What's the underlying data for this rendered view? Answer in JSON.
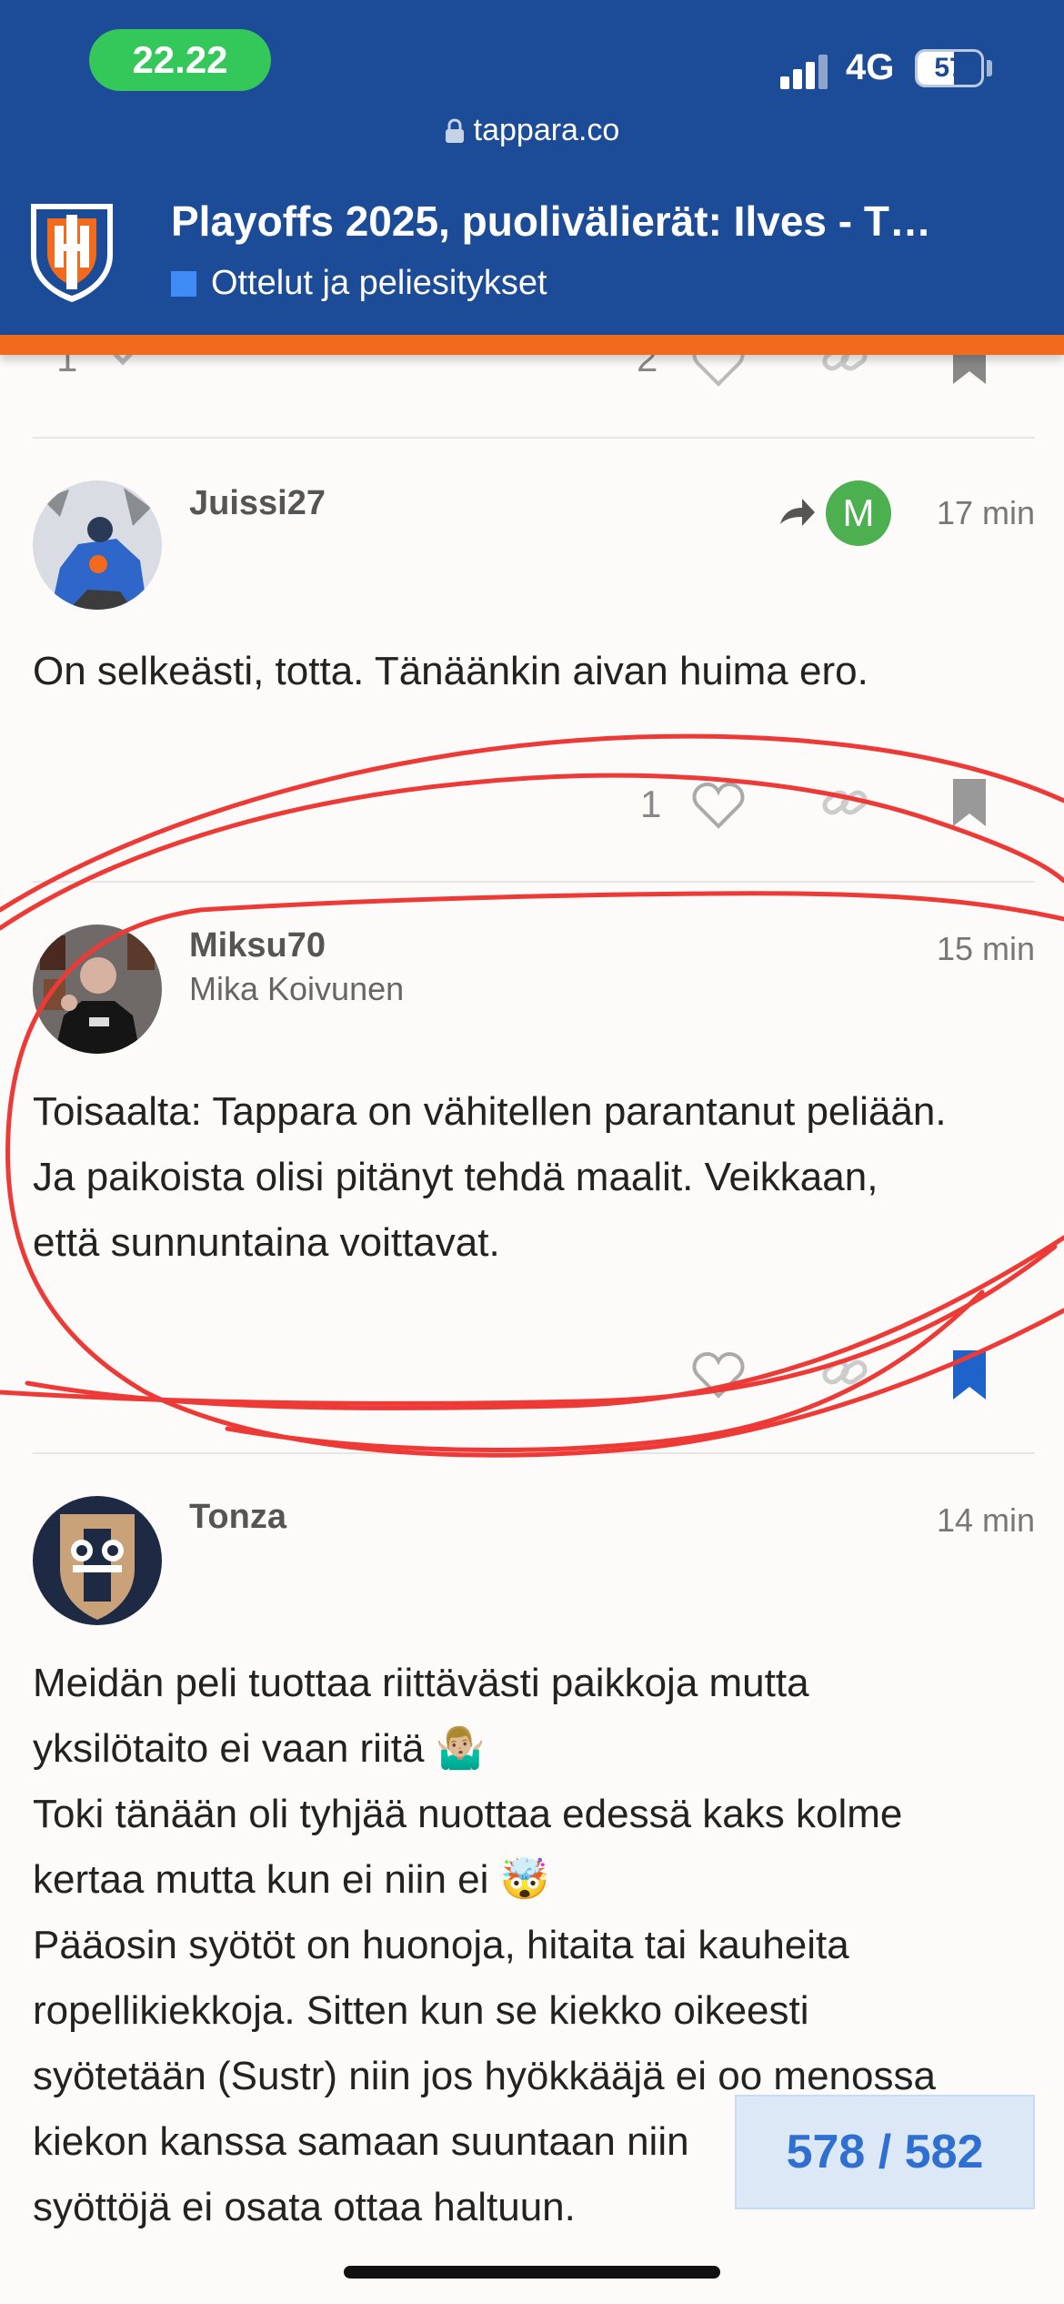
{
  "status_bar": {
    "time": "22.22",
    "network": "4G",
    "battery_label": "57",
    "battery_level": 0.57
  },
  "browser": {
    "url": "tappara.co"
  },
  "topic": {
    "title": "Playoffs 2025, puolivälierät: Ilves - T…",
    "category": "Ottelut ja peliesitykset",
    "category_color": "#3f8cf7"
  },
  "previous_post_actions": {
    "left_count": "1",
    "like_count": "2"
  },
  "posts": [
    {
      "username": "Juissi27",
      "reply_to_initial": "M",
      "age": "17 min",
      "text": [
        "On selkeästi, totta. Tänäänkin aivan huima ero."
      ],
      "like_count": "1"
    },
    {
      "username": "Miksu70",
      "full_name": "Mika Koivunen",
      "age": "15 min",
      "text": [
        "Toisaalta: Tappara on vähitellen parantanut peliään.",
        "Ja paikoista olisi pitänyt tehdä maalit. Veikkaan,",
        "että sunnuntaina voittavat."
      ],
      "bookmarked": true
    },
    {
      "username": "Tonza",
      "age": "14 min",
      "text": [
        "Meidän peli tuottaa riittävästi paikkoja mutta",
        "yksilötaito ei vaan riitä 🤷🏼‍♂️",
        "Toki tänään oli tyhjää nuottaa edessä kaks kolme",
        "kertaa mutta kun ei niin ei 🤯",
        "Pääosin syötöt on huonoja, hitaita tai kauheita",
        "ropellikiekkoja. Sitten kun se kiekko oikeesti",
        "syötetään (Sustr) niin jos hyökkääjä ei oo menossa",
        "kiekon kanssa samaan suuntaan niin",
        "syöttöjä ei osata ottaa haltuun."
      ]
    }
  ],
  "progress": "578 / 582",
  "colors": {
    "header": "#1c4b97",
    "accent_bar": "#f26a1b",
    "bookmark_active": "#1e63c9",
    "annotation": "#ee3a36"
  }
}
